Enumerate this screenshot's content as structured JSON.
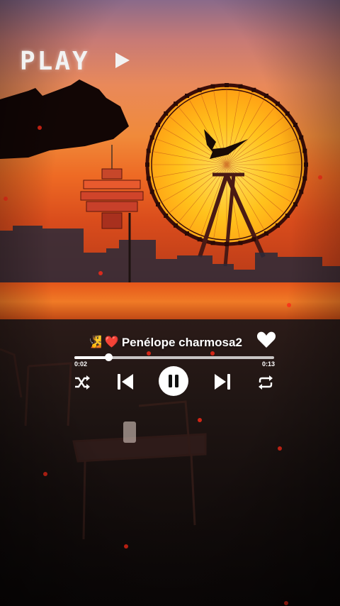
{
  "overlay": {
    "play_label": "PLAY"
  },
  "player": {
    "emoji_1": "🧏",
    "emoji_2": "❤️",
    "title": "Penélope charmosa2",
    "elapsed": "0:02",
    "duration": "0:13",
    "progress_fraction": 0.17,
    "liked": true,
    "state": "playing"
  },
  "icons": {
    "play": "play-triangle-icon",
    "heart": "heart-icon",
    "shuffle": "shuffle-icon",
    "previous": "skip-previous-icon",
    "pause": "pause-icon",
    "next": "skip-next-icon",
    "repeat": "repeat-icon"
  },
  "colors": {
    "accent": "#ffffff",
    "sky_top": "#8a6a8a",
    "sun": "#ffc21c",
    "beach": "#1f1513"
  }
}
